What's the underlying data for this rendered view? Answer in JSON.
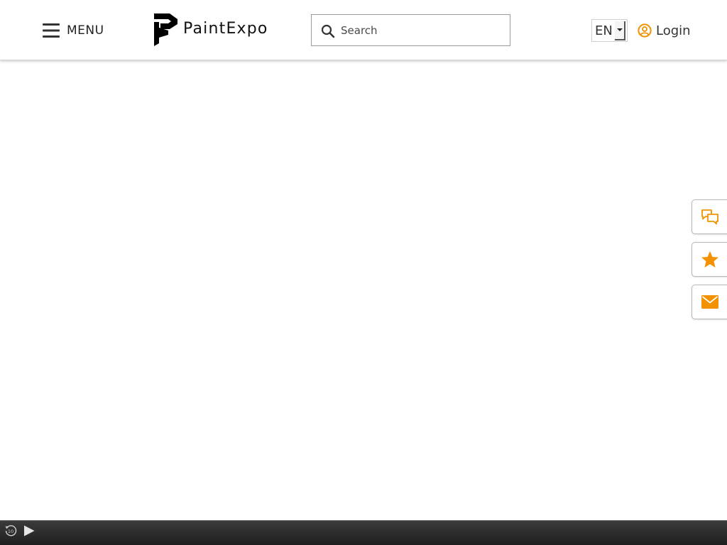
{
  "header": {
    "menu": {
      "label": "MENU",
      "icon": "hamburger-icon"
    },
    "logo": {
      "text": "PaintExpo",
      "icon": "paintexpo-logo-mark"
    },
    "search": {
      "placeholder": "Search",
      "value": "",
      "icon": "search-icon"
    },
    "language": {
      "selected": "EN",
      "icon": "dropdown-arrow-icon"
    },
    "login": {
      "label": "Login",
      "icon": "user-circle-icon"
    }
  },
  "side_buttons": [
    {
      "name": "chat",
      "icon": "chat-bubbles-icon"
    },
    {
      "name": "favorites",
      "icon": "star-icon"
    },
    {
      "name": "newsletter",
      "icon": "envelope-icon"
    }
  ],
  "media_bar": {
    "replay_icon": "replay-10-icon",
    "replay_label": "10",
    "play_icon": "play-icon"
  },
  "colors": {
    "accent": "#f39200",
    "text": "#333333",
    "media_bar": "#2a2a2a"
  }
}
